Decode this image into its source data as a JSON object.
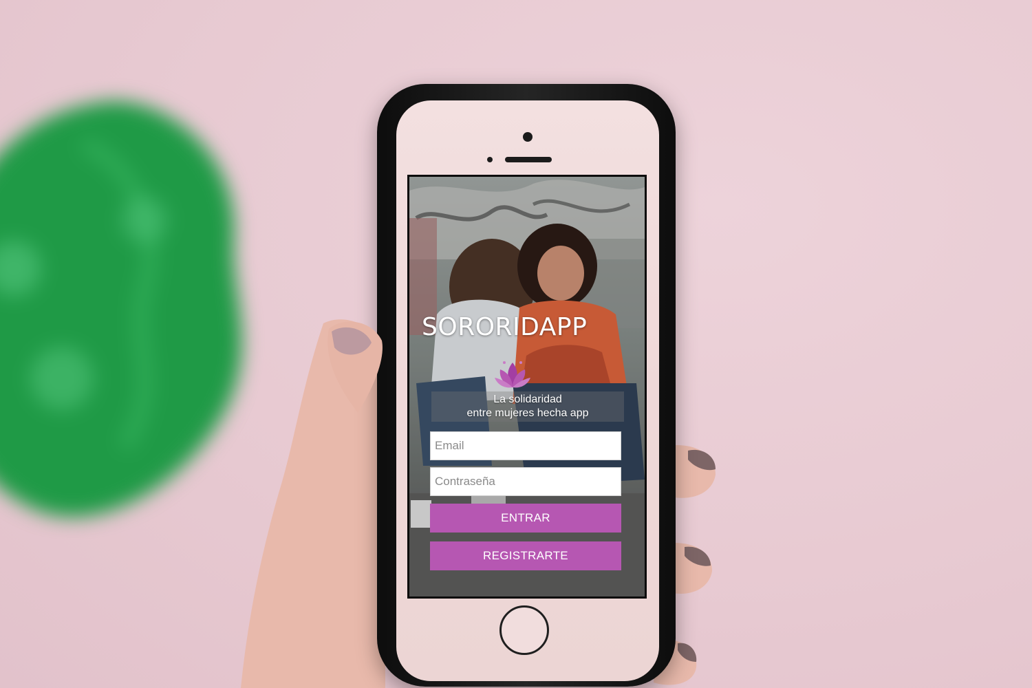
{
  "app": {
    "title": "SORORIDAPP",
    "tagline_line1": "La solidaridad",
    "tagline_line2": "entre mujeres hecha app"
  },
  "login_form": {
    "email_placeholder": "Email",
    "password_placeholder": "Contraseña",
    "login_label": "ENTRAR",
    "register_label": "REGISTRARTE"
  },
  "colors": {
    "accent": "#b657b2",
    "background_wall": "#e9cdd5",
    "logo": "#a33ea3"
  },
  "icons": {
    "logo": "lotus-icon"
  }
}
